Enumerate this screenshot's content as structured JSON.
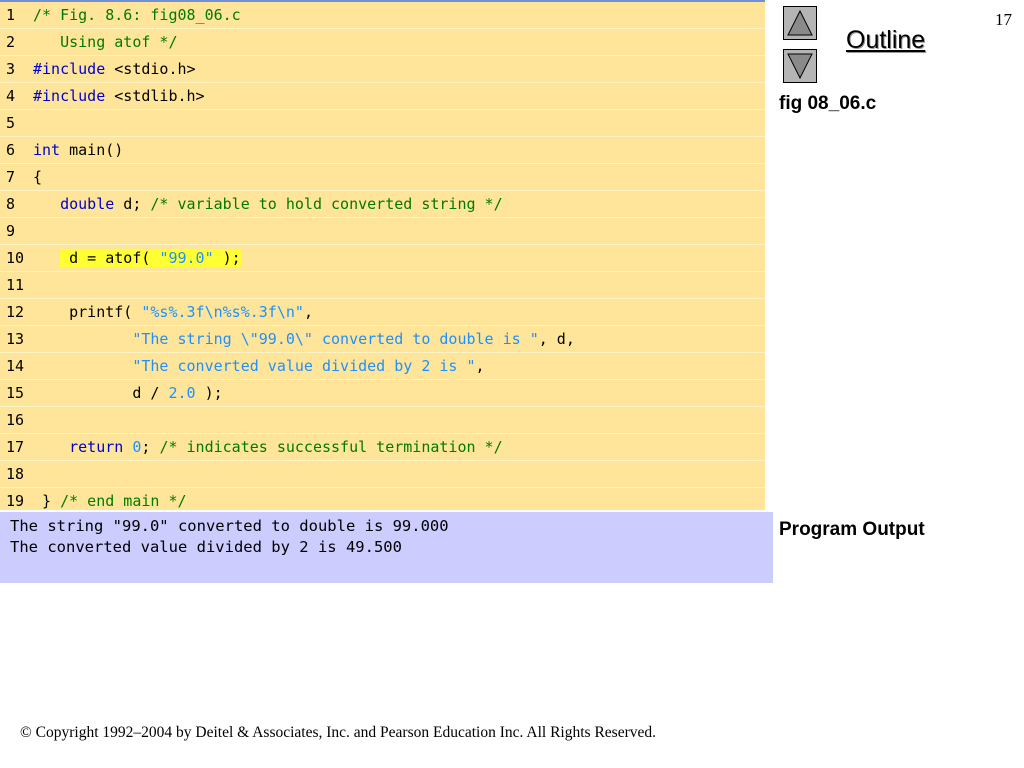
{
  "slide_number": "17",
  "nav": {
    "outline_label": "Outline",
    "up_icon": "triangle-up-icon",
    "down_icon": "triangle-down-icon"
  },
  "side_labels": {
    "file": "fig 08_06.c",
    "program_output": "Program Output"
  },
  "code_lines": [
    {
      "n": "1",
      "segs": [
        {
          "t": "/* Fig. 8.6: fig08_06.c",
          "c": "cm"
        }
      ]
    },
    {
      "n": "2",
      "segs": [
        {
          "t": "   Using atof */",
          "c": "cm"
        }
      ]
    },
    {
      "n": "3",
      "segs": [
        {
          "t": "#include",
          "c": "kw"
        },
        {
          "t": " <stdio.h>",
          "c": ""
        }
      ]
    },
    {
      "n": "4",
      "segs": [
        {
          "t": "#include",
          "c": "kw"
        },
        {
          "t": " <stdlib.h>",
          "c": ""
        }
      ]
    },
    {
      "n": "5",
      "segs": []
    },
    {
      "n": "6",
      "segs": [
        {
          "t": "int",
          "c": "kw"
        },
        {
          "t": " main()",
          "c": ""
        }
      ]
    },
    {
      "n": "7",
      "segs": [
        {
          "t": "{",
          "c": ""
        }
      ]
    },
    {
      "n": "8",
      "segs": [
        {
          "t": "   ",
          "c": ""
        },
        {
          "t": "double",
          "c": "kw"
        },
        {
          "t": " d; ",
          "c": ""
        },
        {
          "t": "/* variable to hold converted string */",
          "c": "cm"
        }
      ]
    },
    {
      "n": "9",
      "segs": []
    },
    {
      "n": "10",
      "segs": [
        {
          "t": "   ",
          "c": ""
        },
        {
          "t": " d = atof( ",
          "c": "hl"
        },
        {
          "t": "\"99.0\"",
          "c": "st hl"
        },
        {
          "t": " );",
          "c": "hl"
        }
      ]
    },
    {
      "n": "11",
      "segs": []
    },
    {
      "n": "12",
      "segs": [
        {
          "t": "    printf( ",
          "c": ""
        },
        {
          "t": "\"%s%.3f\\n%s%.3f\\n\"",
          "c": "st"
        },
        {
          "t": ",",
          "c": ""
        }
      ]
    },
    {
      "n": "13",
      "segs": [
        {
          "t": "           ",
          "c": ""
        },
        {
          "t": "\"The string \\\"99.0\\\" converted to double is \"",
          "c": "st"
        },
        {
          "t": ", d,",
          "c": ""
        }
      ]
    },
    {
      "n": "14",
      "segs": [
        {
          "t": "           ",
          "c": ""
        },
        {
          "t": "\"The converted value divided by 2 is \"",
          "c": "st"
        },
        {
          "t": ",",
          "c": ""
        }
      ]
    },
    {
      "n": "15",
      "segs": [
        {
          "t": "           d / ",
          "c": ""
        },
        {
          "t": "2.0",
          "c": "nm"
        },
        {
          "t": " );",
          "c": ""
        }
      ]
    },
    {
      "n": "16",
      "segs": []
    },
    {
      "n": "17",
      "segs": [
        {
          "t": "    ",
          "c": ""
        },
        {
          "t": "return",
          "c": "kw"
        },
        {
          "t": " ",
          "c": ""
        },
        {
          "t": "0",
          "c": "nm"
        },
        {
          "t": "; ",
          "c": ""
        },
        {
          "t": "/* indicates successful termination */",
          "c": "cm"
        }
      ]
    },
    {
      "n": "18",
      "segs": []
    },
    {
      "n": "19",
      "segs": [
        {
          "t": " } ",
          "c": ""
        },
        {
          "t": "/* end main */",
          "c": "cm"
        }
      ]
    }
  ],
  "output_lines": [
    "The string \"99.0\" converted to double is 99.000",
    "The converted value divided by 2 is 49.500"
  ],
  "copyright": "© Copyright 1992–2004 by Deitel & Associates, Inc. and Pearson Education Inc. All Rights Reserved."
}
